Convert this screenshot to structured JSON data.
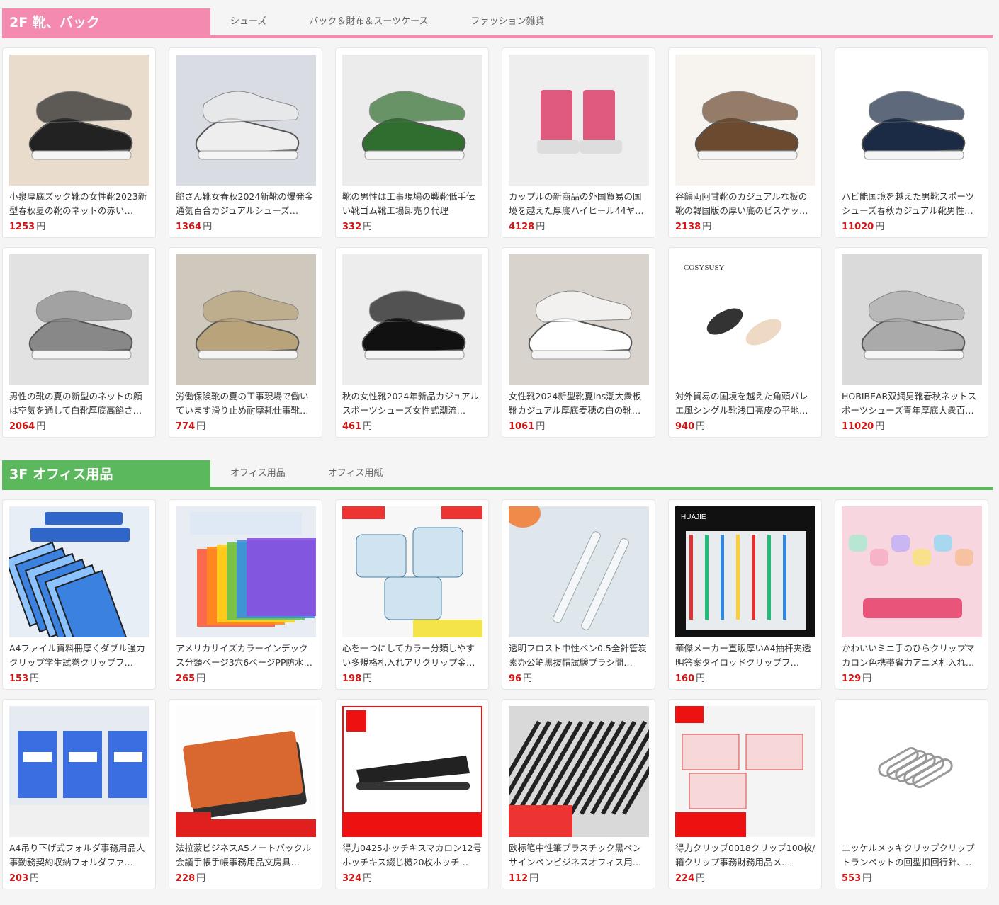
{
  "floors": [
    {
      "title": "2F 靴、バック",
      "color": "#f48aaf",
      "tabs": [
        "シューズ",
        "バック＆財布＆スーツケース",
        "ファッション雑貨"
      ],
      "products": [
        {
          "name": "小泉厚底ズック靴の女性靴2023新型春秋夏の靴のネットの赤い…",
          "price": "1253",
          "unit": "円",
          "img": "shoe"
        },
        {
          "name": "餡さん靴女春秋2024新靴の爆発金通気百合カジュアルシューズ…",
          "price": "1364",
          "unit": "円",
          "img": "shoe"
        },
        {
          "name": "靴の男性は工事現場の戦靴低手伝い靴ゴム靴工場卸売り代理",
          "price": "332",
          "unit": "円",
          "img": "shoe"
        },
        {
          "name": "カップルの新商品の外国貿易の国境を越えた厚底ハイヒール44ヤ…",
          "price": "4128",
          "unit": "円",
          "img": "boot"
        },
        {
          "name": "谷韻両阿甘靴のカジュアルな板の靴の韓国版の厚い底のビスケッ…",
          "price": "2138",
          "unit": "円",
          "img": "shoe"
        },
        {
          "name": "ハビ能国境を越えた男靴スポーツシューズ春秋カジュアル靴男性…",
          "price": "11020",
          "unit": "円",
          "img": "shoe"
        },
        {
          "name": "男性の靴の夏の新型のネットの顔は空気を通して白靴厚底高餡さ…",
          "price": "2064",
          "unit": "円",
          "img": "shoe"
        },
        {
          "name": "労働保険靴の夏の工事現場で働いています滑り止め耐摩耗仕事靴…",
          "price": "774",
          "unit": "円",
          "img": "shoe"
        },
        {
          "name": "秋の女性靴2024年新品カジュアルスポーツシューズ女性式潮流…",
          "price": "461",
          "unit": "円",
          "img": "shoe"
        },
        {
          "name": "女性靴2024新型靴夏ins潮大衆板靴カジュアル厚底麦穂の白の靴…",
          "price": "1061",
          "unit": "円",
          "img": "shoe"
        },
        {
          "name": "対外貿易の国境を越えた角頭バレエ風シングル靴浅口亮皮の平地…",
          "price": "940",
          "unit": "円",
          "img": "flat"
        },
        {
          "name": "HOBIBEAR双網男靴春秋ネットスポーツシューズ青年厚底大衆百…",
          "price": "11020",
          "unit": "円",
          "img": "shoe"
        }
      ]
    },
    {
      "title": "3F オフィス用品",
      "color": "#5cb85c",
      "tabs": [
        "オフィス用品",
        "オフィス用紙"
      ],
      "products": [
        {
          "name": "A4ファイル資料冊厚くダブル強力クリップ学生試巻クリップフ…",
          "price": "153",
          "unit": "円",
          "img": "folder"
        },
        {
          "name": "アメリカサイズカラーインデックス分類ページ3穴6ページPP防水…",
          "price": "265",
          "unit": "円",
          "img": "tabs"
        },
        {
          "name": "心を一つにしてカラー分類しやすい多規格札入れアリクリップ金…",
          "price": "198",
          "unit": "円",
          "img": "clips"
        },
        {
          "name": "透明フロスト中性ペン0.5全針管炭素办公笔黒抜帽試験プラシ問…",
          "price": "96",
          "unit": "円",
          "img": "pen"
        },
        {
          "name": "華傑メーカー直販厚いA4抽杆夹透明答案タイロッドクリップフ…",
          "price": "160",
          "unit": "円",
          "img": "sheet"
        },
        {
          "name": "かわいいミニ手のひらクリップマカロン色携帯省力アニメ札入れ…",
          "price": "129",
          "unit": "円",
          "img": "mini"
        },
        {
          "name": "A4吊り下げ式フォルダ事務用品人事勤務契約収納フォルダファ…",
          "price": "203",
          "unit": "円",
          "img": "hang"
        },
        {
          "name": "法拉蒙ビジネスA5ノートバックル会議手帳手帳事務用品文房具…",
          "price": "228",
          "unit": "円",
          "img": "note"
        },
        {
          "name": "得力0425ホッチキスマカロン12号ホッチキス綴じ機20枚ホッチ…",
          "price": "324",
          "unit": "円",
          "img": "stapler"
        },
        {
          "name": "欧标笔中性筆プラスチック黒ペンサインペンビジネスオフィス用…",
          "price": "112",
          "unit": "円",
          "img": "pens"
        },
        {
          "name": "得力クリップ0018クリップ100枚/箱クリップ事務財務用品メ…",
          "price": "224",
          "unit": "円",
          "img": "box"
        },
        {
          "name": "ニッケルメッキクリップクリップトランペットの回型扣回行針、…",
          "price": "553",
          "unit": "円",
          "img": "paperclip"
        }
      ]
    }
  ]
}
